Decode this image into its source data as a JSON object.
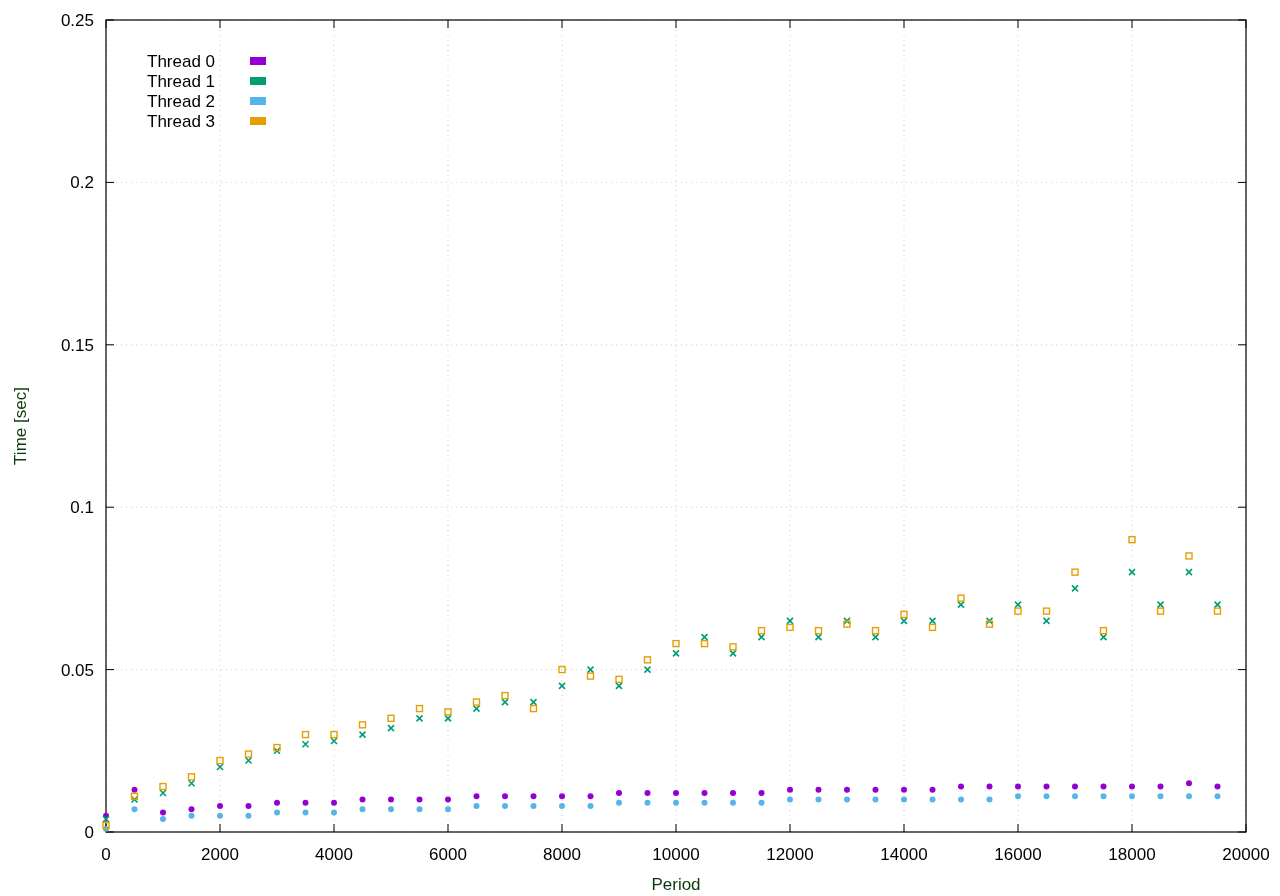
{
  "chart": {
    "chart_data": {
      "type": "scatter",
      "grid": true,
      "legend": "top left",
      "xlabel": "Period",
      "ylabel": "Time [sec]",
      "xlim": [
        0,
        20000
      ],
      "ylim": [
        0,
        0.25
      ],
      "xticks": [
        0,
        2000,
        4000,
        6000,
        8000,
        10000,
        12000,
        14000,
        16000,
        18000,
        20000
      ],
      "yticks": [
        {
          "value": 0,
          "label": "0"
        },
        {
          "value": 0.05,
          "label": "0.05"
        },
        {
          "value": 0.1,
          "label": "0.1"
        },
        {
          "value": 0.15,
          "label": "0.15"
        },
        {
          "value": 0.2,
          "label": "0.2"
        },
        {
          "value": 0.25,
          "label": "0.25"
        }
      ],
      "x": [
        0,
        500,
        1000,
        1500,
        2000,
        2500,
        3000,
        3500,
        4000,
        4500,
        5000,
        5500,
        6000,
        6500,
        7000,
        7500,
        8000,
        8500,
        9000,
        9500,
        10000,
        10500,
        11000,
        11500,
        12000,
        12500,
        13000,
        13500,
        14000,
        14500,
        15000,
        15500,
        16000,
        16500,
        17000,
        17500,
        18000,
        18500,
        19000,
        19500
      ],
      "series": [
        {
          "name": "Thread 0",
          "color": "#9400d3",
          "values": [
            0.005,
            0.013,
            0.006,
            0.007,
            0.008,
            0.008,
            0.009,
            0.009,
            0.009,
            0.01,
            0.01,
            0.01,
            0.01,
            0.011,
            0.011,
            0.011,
            0.011,
            0.011,
            0.012,
            0.012,
            0.012,
            0.012,
            0.012,
            0.012,
            0.013,
            0.013,
            0.013,
            0.013,
            0.013,
            0.013,
            0.014,
            0.014,
            0.014,
            0.014,
            0.014,
            0.014,
            0.014,
            0.014,
            0.015,
            0.014
          ]
        },
        {
          "name": "Thread 1",
          "color": "#009e73",
          "values": [
            0.004,
            0.01,
            0.012,
            0.015,
            0.02,
            0.022,
            0.025,
            0.027,
            0.028,
            0.03,
            0.032,
            0.035,
            0.035,
            0.038,
            0.04,
            0.04,
            0.045,
            0.05,
            0.045,
            0.05,
            0.055,
            0.06,
            0.055,
            0.06,
            0.065,
            0.06,
            0.065,
            0.06,
            0.065,
            0.065,
            0.07,
            0.065,
            0.07,
            0.065,
            0.075,
            0.06,
            0.08,
            0.07,
            0.08,
            0.07
          ]
        },
        {
          "name": "Thread 2",
          "color": "#56b4e9",
          "values": [
            0.001,
            0.007,
            0.004,
            0.005,
            0.005,
            0.005,
            0.006,
            0.006,
            0.006,
            0.007,
            0.007,
            0.007,
            0.007,
            0.008,
            0.008,
            0.008,
            0.008,
            0.008,
            0.009,
            0.009,
            0.009,
            0.009,
            0.009,
            0.009,
            0.01,
            0.01,
            0.01,
            0.01,
            0.01,
            0.01,
            0.01,
            0.01,
            0.011,
            0.011,
            0.011,
            0.011,
            0.011,
            0.011,
            0.011,
            0.011
          ]
        },
        {
          "name": "Thread 3",
          "color": "#e69f00",
          "values": [
            0.002,
            0.011,
            0.014,
            0.017,
            0.022,
            0.024,
            0.026,
            0.03,
            0.03,
            0.033,
            0.035,
            0.038,
            0.037,
            0.04,
            0.042,
            0.038,
            0.05,
            0.048,
            0.047,
            0.053,
            0.058,
            0.058,
            0.057,
            0.062,
            0.063,
            0.062,
            0.064,
            0.062,
            0.067,
            0.063,
            0.072,
            0.064,
            0.068,
            0.068,
            0.08,
            0.062,
            0.09,
            0.068,
            0.085,
            0.068
          ]
        }
      ]
    }
  }
}
